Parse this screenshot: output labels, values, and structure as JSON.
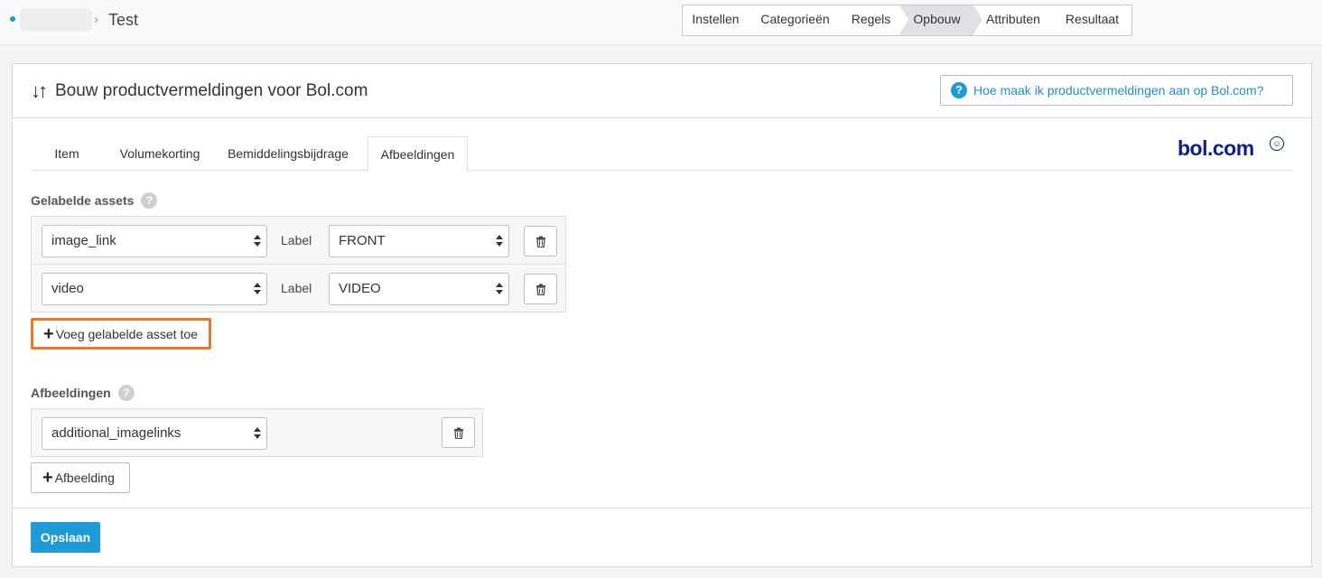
{
  "breadcrumb": {
    "separator": "›",
    "title": "Test"
  },
  "steps": [
    {
      "label": "Instellen",
      "active": false
    },
    {
      "label": "Categorieën",
      "active": false
    },
    {
      "label": "Regels",
      "active": false
    },
    {
      "label": "Opbouw",
      "active": true
    },
    {
      "label": "Attributen",
      "active": false
    },
    {
      "label": "Resultaat",
      "active": false
    }
  ],
  "panel": {
    "icon": "sort-arrows-icon",
    "title": "Bouw productvermeldingen voor Bol.com",
    "help_label": "Hoe maak ik productvermeldingen aan op Bol.com?",
    "help_icon": "question-circle-icon"
  },
  "tabs": [
    {
      "label": "Item",
      "active": false
    },
    {
      "label": "Volumekorting",
      "active": false
    },
    {
      "label": "Bemiddelingsbijdrage",
      "active": false
    },
    {
      "label": "Afbeeldingen",
      "active": true
    }
  ],
  "logo": {
    "text": "bol.com"
  },
  "labeled_assets": {
    "heading": "Gelabelde assets",
    "label_text": "Label",
    "rows": [
      {
        "field": "image_link",
        "label": "FRONT"
      },
      {
        "field": "video",
        "label": "VIDEO"
      }
    ],
    "add_button": "Voeg gelabelde asset toe"
  },
  "images": {
    "heading": "Afbeeldingen",
    "rows": [
      {
        "field": "additional_imagelinks"
      }
    ],
    "add_button": "Afbeelding"
  },
  "save_button": "Opslaan",
  "colors": {
    "accent": "#1e9bd7",
    "highlight": "#e8792a",
    "logo": "#0b1f8f"
  }
}
